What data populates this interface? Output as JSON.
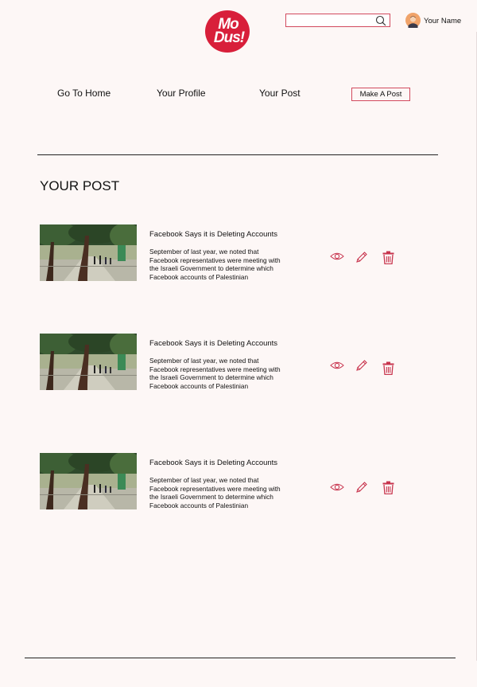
{
  "brand": {
    "logo_line1": "Mo",
    "logo_line2": "Dus!",
    "color": "#d81f3a"
  },
  "header": {
    "search": {
      "value": "",
      "placeholder": "",
      "icon": "search-icon"
    },
    "user": {
      "name": "Your Name",
      "icon": "avatar"
    }
  },
  "nav": {
    "home": "Go To Home",
    "profile": "Your Profile",
    "posts": "Your Post",
    "make_post": "Make A Post"
  },
  "page": {
    "title": "YOUR POST"
  },
  "posts": [
    {
      "title": "Facebook Says it is Deleting Accounts",
      "excerpt": "September of last year, we noted that Facebook representatives were meeting with the Israeli Government to determine which Facebook accounts of Palestinian"
    },
    {
      "title": "Facebook Says it is Deleting Accounts",
      "excerpt": "September of last year, we noted that Facebook representatives were meeting with the Israeli Government to determine which Facebook accounts of Palestinian"
    },
    {
      "title": "Facebook Says it is Deleting Accounts",
      "excerpt": "September of last year, we noted that Facebook representatives were meeting with the Israeli Government to determine which Facebook accounts of Palestinian"
    }
  ],
  "actions": {
    "view_icon": "eye-icon",
    "edit_icon": "pencil-icon",
    "delete_icon": "trash-icon"
  },
  "colors": {
    "accent": "#d24a5e",
    "background": "#fdf7f6",
    "icon": "#c8344d"
  }
}
